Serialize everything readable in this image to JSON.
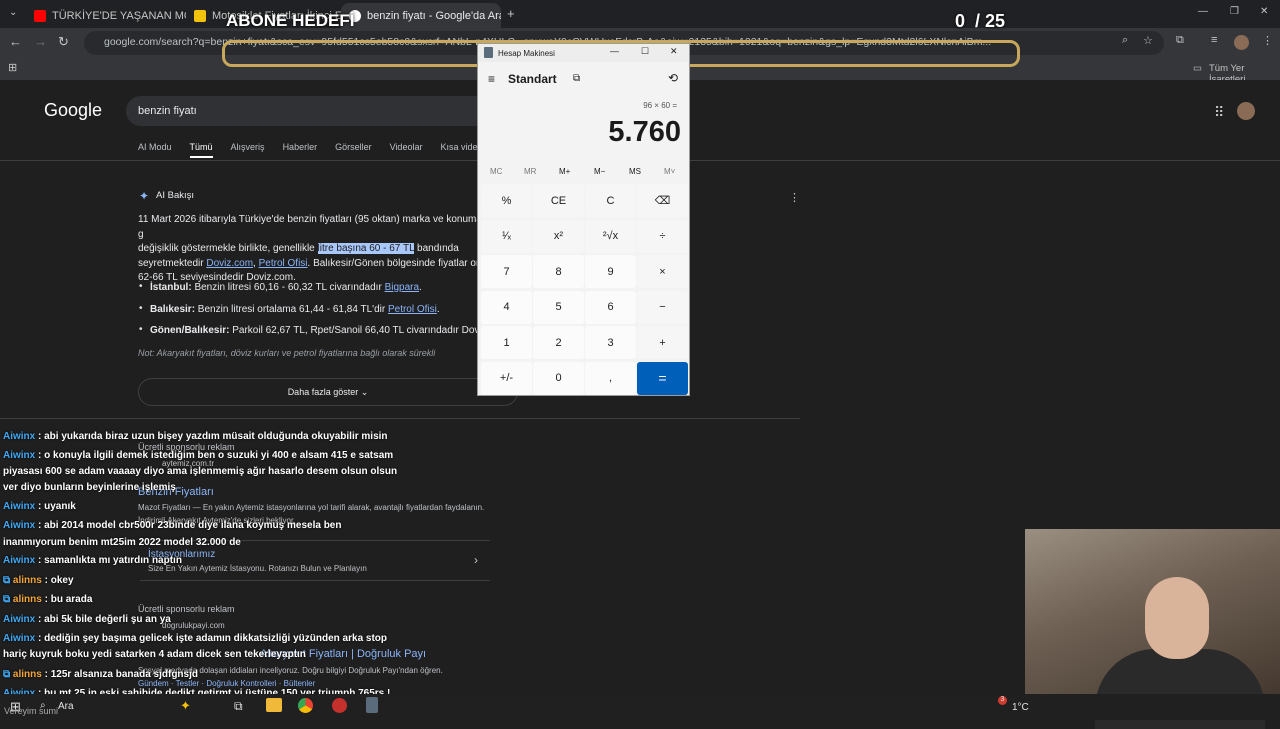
{
  "browser": {
    "tabs": [
      {
        "label": "TÜRKİYE'DE YAŞANAN MOTORL"
      },
      {
        "label": "Motosiklet Fiyatları İkinci El ve"
      },
      {
        "label": "benzin fiyatı - Google'da Ara"
      }
    ],
    "url": "google.com/search?q=benzin+fiyatı&sca_esv=95fd551cc5eb58c0&sxsrf=ANbL-n4XHLC...spuwaY0cCVWHxoFdsrB-Ao&oiw=2135&bih=1021&oq=benzin&gs_lp=Egxnd3Mtd2l6LXNlcnAiBm...",
    "bookmarks_label": "Tüm Yer İşaretleri"
  },
  "overlay": {
    "goal_label": "ABONE HEDEFİ",
    "goal_count": "0  / 25"
  },
  "google": {
    "logo": "Google",
    "query": "benzin fiyatı",
    "filters": [
      "AI Modu",
      "Tümü",
      "Alışveriş",
      "Haberler",
      "Görseller",
      "Videolar",
      "Kısa videolar"
    ],
    "ai_title": "AI Bakışı",
    "ai_p1": "11 Mart 2026 itibarıyla Türkiye'de benzin fiyatları (95 oktan) marka ve konuma g",
    "ai_p2a": "değişiklik göstermekle birlikte, genellikle ",
    "ai_p2hl": "litre başına 60 - 67 TL",
    "ai_p2b": " bandında",
    "ai_p3a": "seyretmektedir ",
    "ai_link1": "Doviz.com",
    "ai_link2": "Petrol Ofisi",
    "ai_p3b": ". Balıkesir/Gönen bölgesinde fiyatlar ort",
    "ai_p4": "62-66 TL seviyesindedir Doviz.com.",
    "b1_city": "İstanbul:",
    "b1_text": " Benzin litresi 60,16 - 60,32 TL civarındadır ",
    "b1_link": "Bigpara",
    "b2_city": "Balıkesir:",
    "b2_text": " Benzin litresi ortalama 61,44 - 61,84 TL'dir ",
    "b2_link": "Petrol Ofisi",
    "b3_city": "Gönen/Balıkesir:",
    "b3_text": " Parkoil 62,67 TL, Rpet/Sanoil 66,40 TL civarındadır Doviz.",
    "note": "Not: Akaryakıt fiyatları, döviz kurları ve petrol fiyatlarına bağlı olarak sürekli",
    "more_btn": "Daha fazla göster",
    "ad1_label": "Ücretli sponsorlu reklam",
    "ad1_domain": "aytemiz.com.tr",
    "ad1_title": "Benzin Fiyatları",
    "ad1_desc": "Mazot Fiyatları — En yakın Aytemiz istasyonlarına yol tarifi alarak, avantajlı fiyatlardan faydalanın.",
    "ad1_desc2": "İndirimli Akaryakıt Aytemiz'de sizleri bekliyor.",
    "ad1_sub": "İstasyonlarımız",
    "ad1_subdesc": "Size En Yakın Aytemiz İstasyonu. Rotanızı Bulun ve Planlayın",
    "ad2_label": "Ücretli sponsorlu reklam",
    "ad2_domain": "dogrulukpayi.com",
    "ad2_title": "Akaryakıt Fiyatları | Doğruluk Payı",
    "ad2_desc": "Sosyal medyada dolaşan iddiaları inceliyoruz. Doğru bilgiyi Doğruluk Payı'ndan öğren.",
    "ad2_links": "Gündem · Testler · Doğruluk Kontrolleri · Bültenler"
  },
  "chat": [
    {
      "user": "Aiwinx",
      "text": " : abi yukarıda biraz uzun bişey yazdım müsait olduğunda okuyabilir misin"
    },
    {
      "user": "Aiwinx",
      "text": " : o konuyla ilgili demek istediğim ben o suzuki yi 400 e alsam 415 e satsam"
    },
    {
      "user": "",
      "text": "piyasası 600 se adam vaaaay diyo ama işlenmemiş ağır hasarlo desem olsun olsun"
    },
    {
      "user": "",
      "text": "ver diyo bunların beyinlerine işlemiş"
    },
    {
      "user": "Aiwinx",
      "text": " : uyanık"
    },
    {
      "user": "Aiwinx",
      "text": " : abi 2014 model cbr500r 23binde diye ilana koymuş mesela ben"
    },
    {
      "user": "",
      "text": "inanmıyorum benim mt25im 2022 model 32.000 de"
    },
    {
      "user": "Aiwinx",
      "text": " : samanlıkta mı yatırdın naptın"
    },
    {
      "user": "alinns",
      "text": " : okey"
    },
    {
      "user": "alinns",
      "text": " : bu arada"
    },
    {
      "user": "Aiwinx",
      "text": " : abi 5k bile değerli şu an ya"
    },
    {
      "user": "Aiwinx",
      "text": " : dediğin şey başıma gelicek işte adamın dikkatsizliği yüzünden arka stop"
    },
    {
      "user": "",
      "text": "hariç kuyruk boku yedi satarken 4 adam dicek sen tekerleyaptın"
    },
    {
      "user": "alinns",
      "text": " : 125r alsanıza banada sjdfgnsjd"
    },
    {
      "user": "Aiwinx",
      "text": " : bu mt 25 in eski sahibide dedikt getirmt yi üstüne 150 ver triumph 765rs !"
    }
  ],
  "calculator": {
    "window_title": "Hesap Makinesi",
    "mode": "Standart",
    "expression": "96 × 60 =",
    "result": "5.760",
    "memory": [
      "MC",
      "MR",
      "M+",
      "M−",
      "MS",
      "M˅"
    ],
    "keys": [
      [
        "%",
        "CE",
        "C",
        "⌫"
      ],
      [
        "¹⁄ₓ",
        "x²",
        "²√x",
        "÷"
      ],
      [
        "7",
        "8",
        "9",
        "×"
      ],
      [
        "4",
        "5",
        "6",
        "−"
      ],
      [
        "1",
        "2",
        "3",
        "+"
      ],
      [
        "+/-",
        "0",
        ",",
        "="
      ]
    ]
  },
  "taskbar": {
    "search": "Ara",
    "left_text": "Vereyim sumi",
    "notif_count": "3",
    "temp": "1°C"
  }
}
